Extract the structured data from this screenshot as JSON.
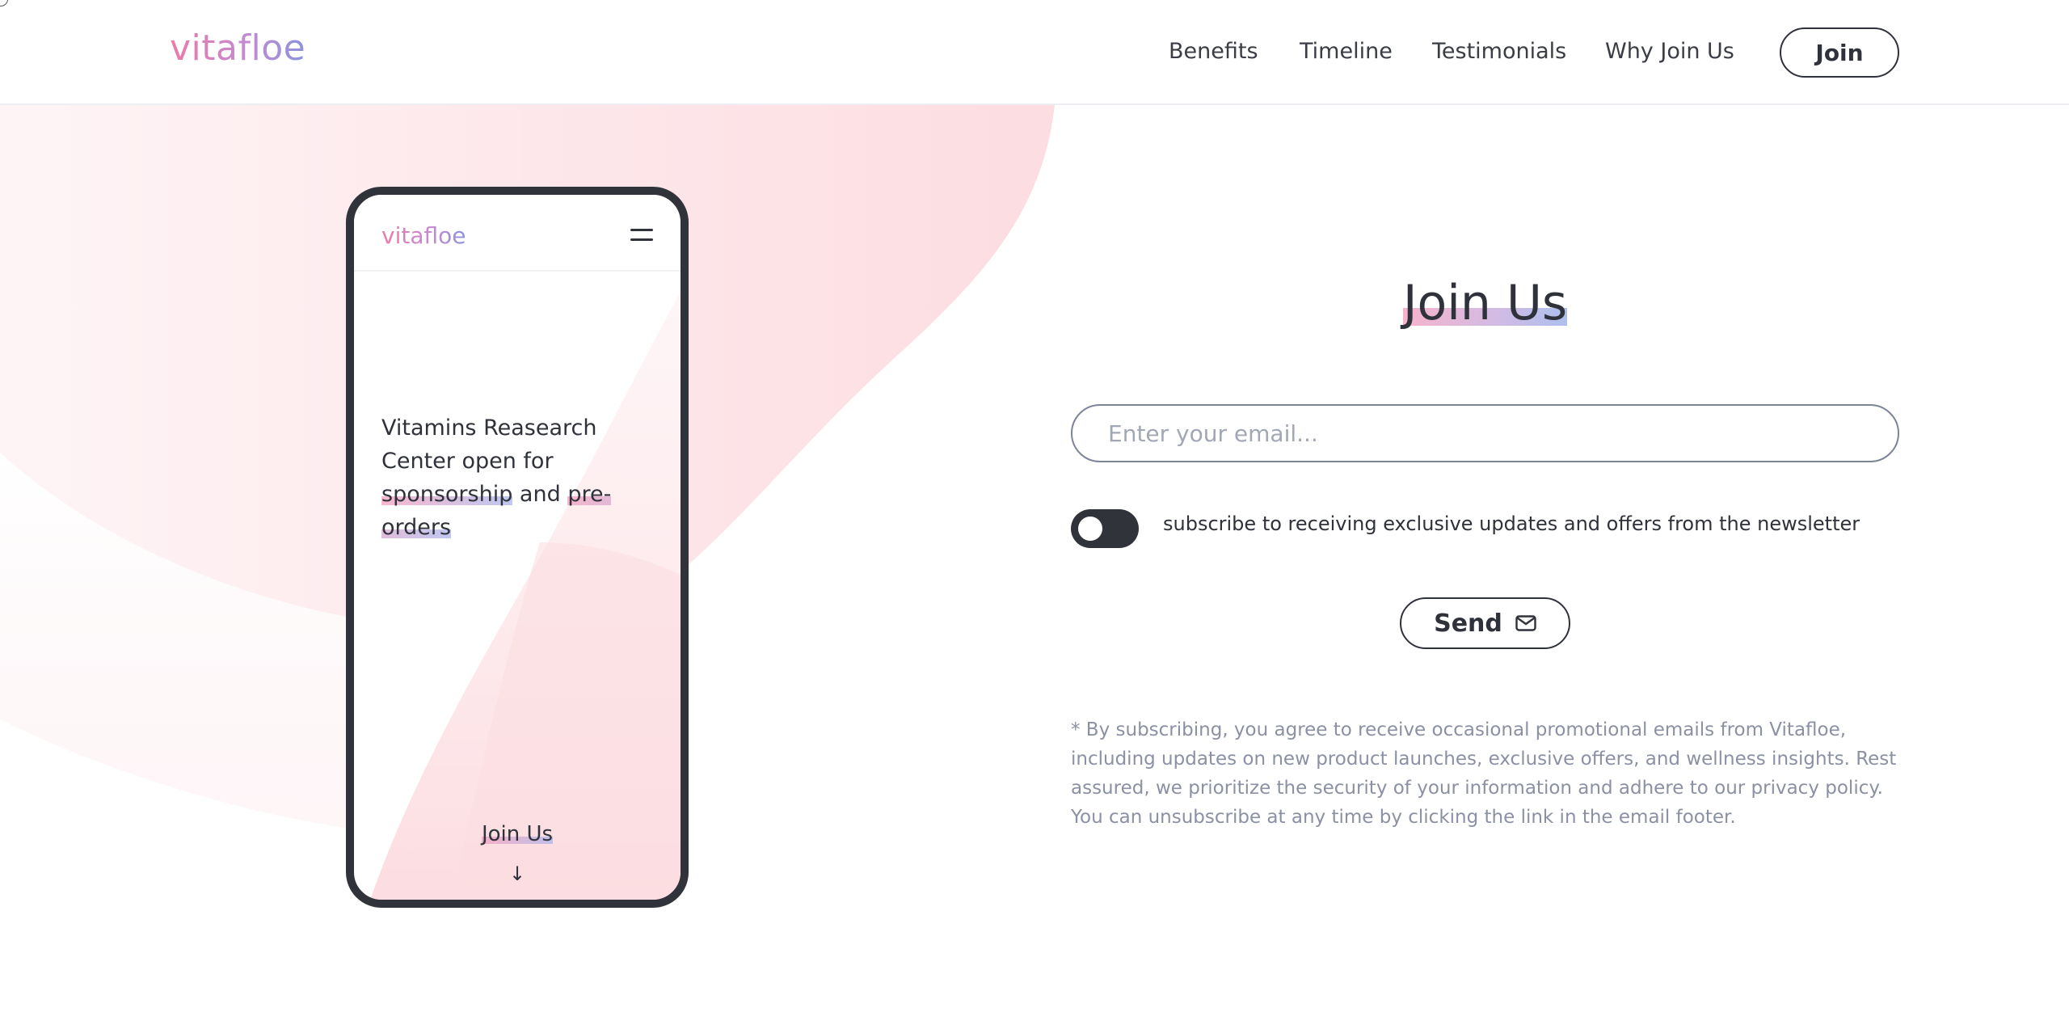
{
  "header": {
    "logo": "vitafloe",
    "nav": {
      "benefits": "Benefits",
      "timeline": "Timeline",
      "testimonials": "Testimonials",
      "why_join": "Why Join Us"
    },
    "join_label": "Join"
  },
  "phone": {
    "logo": "vitafloe",
    "headline_part1": "Vitamins Reasearch Center open for ",
    "headline_hl1": "sponsorship",
    "headline_part2": " and ",
    "headline_hl2": "pre-orders",
    "cta": "Join Us",
    "arrow": "↓"
  },
  "form": {
    "title": "Join Us",
    "email_placeholder": "Enter your email...",
    "email_value": "",
    "newsletter_toggle_on": false,
    "newsletter_label": "subscribe to receiving exclusive updates and offers from the newsletter",
    "send_label": "Send",
    "disclaimer": "* By subscribing, you agree to receive occasional promotional emails from Vitafloe, including updates on new product launches, exclusive offers, and wellness insights. Rest assured, we prioritize the security of your information and adhere to our privacy policy. You can unsubscribe at any time by clicking the link in the email footer."
  },
  "icons": {
    "menu": "hamburger-menu-icon",
    "send": "envelope-icon",
    "arrow": "arrow-down-icon"
  },
  "colors": {
    "text_dark": "#2f323a",
    "muted": "#8b91a3",
    "brand_pink": "#ec7aa8",
    "brand_violet": "#8b93de",
    "blob_pink": "#fde2e6"
  }
}
